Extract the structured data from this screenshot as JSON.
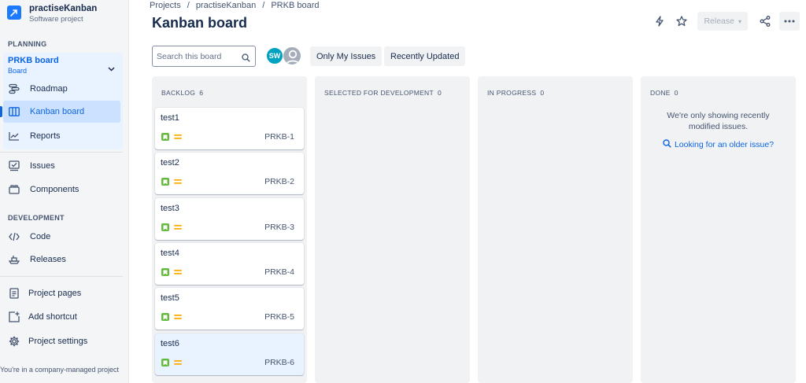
{
  "project": {
    "name": "practiseKanban",
    "type": "Software project"
  },
  "sidebar": {
    "planning_title": "PLANNING",
    "board_selector": {
      "name": "PRKB board",
      "sub": "Board"
    },
    "planning_items": [
      {
        "label": "Roadmap",
        "icon": "roadmap-icon"
      },
      {
        "label": "Kanban board",
        "icon": "board-icon",
        "active": true
      },
      {
        "label": "Reports",
        "icon": "reports-icon"
      }
    ],
    "other_items": [
      {
        "label": "Issues",
        "icon": "issues-icon"
      },
      {
        "label": "Components",
        "icon": "components-icon"
      }
    ],
    "development_title": "DEVELOPMENT",
    "development_items": [
      {
        "label": "Code",
        "icon": "code-icon"
      },
      {
        "label": "Releases",
        "icon": "releases-icon"
      }
    ],
    "bottom_items": [
      {
        "label": "Project pages",
        "icon": "page-icon"
      },
      {
        "label": "Add shortcut",
        "icon": "add-shortcut-icon"
      },
      {
        "label": "Project settings",
        "icon": "gear-icon"
      }
    ],
    "footer_note": "You're in a company-managed project"
  },
  "breadcrumb": [
    "Projects",
    "practiseKanban",
    "PRKB board"
  ],
  "page_title": "Kanban board",
  "toolbar": {
    "release_label": "Release"
  },
  "search": {
    "placeholder": "Search this board"
  },
  "avatars": {
    "sw_initials": "SW"
  },
  "filters": {
    "only_my_issues": "Only My Issues",
    "recently_updated": "Recently Updated"
  },
  "columns": [
    {
      "title": "BACKLOG",
      "count": "6",
      "cards": [
        {
          "title": "test1",
          "key": "PRKB-1"
        },
        {
          "title": "test2",
          "key": "PRKB-2"
        },
        {
          "title": "test3",
          "key": "PRKB-3"
        },
        {
          "title": "test4",
          "key": "PRKB-4"
        },
        {
          "title": "test5",
          "key": "PRKB-5"
        },
        {
          "title": "test6",
          "key": "PRKB-6",
          "highlighted": true
        }
      ]
    },
    {
      "title": "SELECTED FOR DEVELOPMENT",
      "count": "0",
      "cards": []
    },
    {
      "title": "IN PROGRESS",
      "count": "0",
      "cards": []
    },
    {
      "title": "DONE",
      "count": "0",
      "cards": []
    }
  ],
  "done_column": {
    "message": "We're only showing recently modified issues.",
    "link": "Looking for an older issue?"
  },
  "colors": {
    "accent": "#0c66e4",
    "story": "#63ba3c",
    "priority_medium": "#ffab00",
    "avatar_sw": "#00a3bf"
  }
}
